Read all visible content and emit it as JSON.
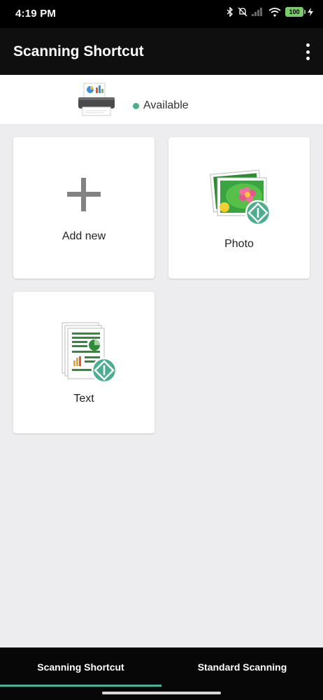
{
  "status_bar": {
    "time": "4:19 PM",
    "battery": "100"
  },
  "app_bar": {
    "title": "Scanning Shortcut"
  },
  "device": {
    "status": "Available",
    "status_color": "#4caf89"
  },
  "cards": [
    {
      "label": "Add new",
      "icon": "plus-icon"
    },
    {
      "label": "Photo",
      "icon": "photo-icon"
    },
    {
      "label": "Text",
      "icon": "document-icon"
    }
  ],
  "bottom_nav": {
    "tabs": [
      {
        "label": "Scanning Shortcut",
        "selected": true
      },
      {
        "label": "Standard Scanning",
        "selected": false
      }
    ],
    "accent": "#4caf9a"
  }
}
